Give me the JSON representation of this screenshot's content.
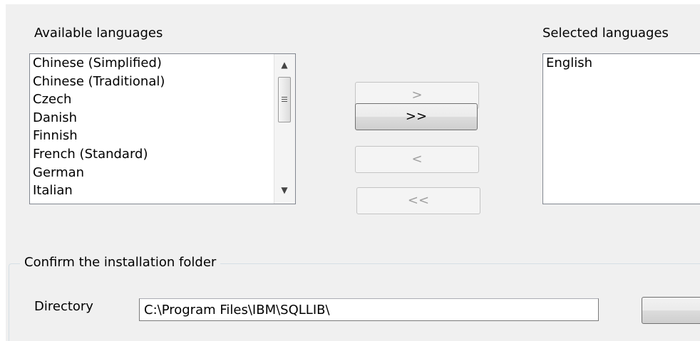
{
  "available": {
    "label": "Available languages",
    "items": [
      "Chinese (Simplified)",
      "Chinese (Traditional)",
      "Czech",
      "Danish",
      "Finnish",
      "French (Standard)",
      "German",
      "Italian"
    ]
  },
  "selected": {
    "label": "Selected languages",
    "items": [
      "English"
    ]
  },
  "buttons": {
    "add": ">",
    "add_all": ">>",
    "remove": "<",
    "remove_all": "<<"
  },
  "folder": {
    "legend": "Confirm the installation folder",
    "directory_label": "Directory",
    "directory_value": "C:\\Program Files\\IBM\\SQLLIB\\"
  }
}
